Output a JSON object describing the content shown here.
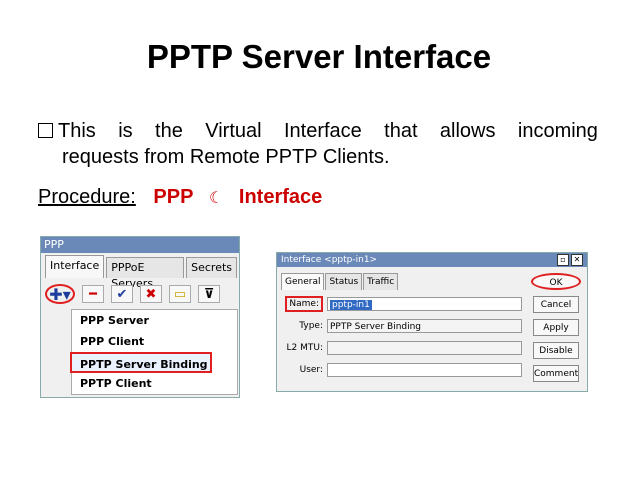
{
  "slide": {
    "title": "PPTP Server Interface",
    "bullet_line1_words": [
      "This",
      "is",
      "the",
      "Virtual",
      "Interface",
      "that",
      "allows",
      "incoming"
    ],
    "bullet_line2": "requests from Remote PPTP Clients.",
    "procedure_label": "Procedure:",
    "procedure_ppp": "PPP",
    "procedure_arrow": "☾",
    "procedure_interface": "Interface"
  },
  "ppp_window": {
    "title": "PPP",
    "tabs": [
      "Interface",
      "PPPoE Servers",
      "Secrets"
    ],
    "toolbar": {
      "add": "✚▾",
      "remove": "━",
      "enable": "✔",
      "disable": "✖",
      "comment": "▭",
      "filter": "⊽"
    },
    "menu_items": [
      "PPP Server",
      "PPP Client",
      "PPTP Server Binding",
      "PPTP Client"
    ]
  },
  "interface_dialog": {
    "title": "Interface <pptp-in1>",
    "tabs": [
      "General",
      "Status",
      "Traffic"
    ],
    "name_label": "Name:",
    "name_value": "pptp-in1",
    "type_label": "Type:",
    "type_value": "PPTP Server Binding",
    "l2mtu_label": "L2 MTU:",
    "l2mtu_value": "",
    "user_label": "User:",
    "user_value": "",
    "buttons": {
      "ok": "OK",
      "cancel": "Cancel",
      "apply": "Apply",
      "disable": "Disable",
      "comment": "Comment"
    }
  },
  "colors": {
    "accent_red": "#cc0000",
    "titlebar": "#6b89b8",
    "highlight": "#e02020"
  }
}
